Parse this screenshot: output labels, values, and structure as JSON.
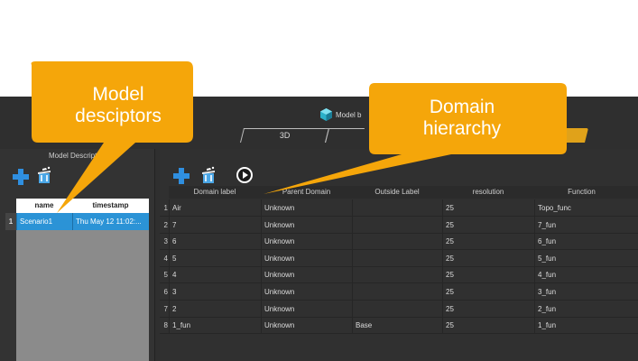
{
  "app": {
    "title": "Model b",
    "tabs": [
      {
        "label": "3D"
      },
      {
        "label": ""
      },
      {
        "label": "s"
      }
    ],
    "colors": {
      "background": "#2f2f2f",
      "accent": "#e0a21a",
      "selection": "#2b93d6"
    }
  },
  "left_panel": {
    "title": "Model Descript",
    "toolbar": {
      "add_icon": "plus-icon",
      "clear_icon": "bin-icon"
    },
    "table": {
      "columns": [
        "name",
        "timestamp"
      ],
      "rows": [
        {
          "num": "1",
          "name": "Scenario1",
          "timestamp": "Thu May 12 11:02:..."
        }
      ]
    }
  },
  "right_panel": {
    "toolbar": {
      "add_icon": "plus-icon",
      "clear_icon": "bin-icon",
      "run_icon": "play-icon"
    },
    "table": {
      "columns": [
        "Domain label",
        "Parent Domain",
        "Outside Label",
        "resolution",
        "Function"
      ],
      "rows": [
        {
          "num": "1",
          "label": "Air",
          "parent": "Unknown",
          "outside": "",
          "resolution": "25",
          "function": "Topo_func"
        },
        {
          "num": "2",
          "label": "7",
          "parent": "Unknown",
          "outside": "",
          "resolution": "25",
          "function": "7_fun"
        },
        {
          "num": "3",
          "label": "6",
          "parent": "Unknown",
          "outside": "",
          "resolution": "25",
          "function": "6_fun"
        },
        {
          "num": "4",
          "label": "5",
          "parent": "Unknown",
          "outside": "",
          "resolution": "25",
          "function": "5_fun"
        },
        {
          "num": "5",
          "label": "4",
          "parent": "Unknown",
          "outside": "",
          "resolution": "25",
          "function": "4_fun"
        },
        {
          "num": "6",
          "label": "3",
          "parent": "Unknown",
          "outside": "",
          "resolution": "25",
          "function": "3_fun"
        },
        {
          "num": "7",
          "label": "2",
          "parent": "Unknown",
          "outside": "",
          "resolution": "25",
          "function": "2_fun"
        },
        {
          "num": "8",
          "label": "1_fun",
          "parent": "Unknown",
          "outside": "Base",
          "resolution": "25",
          "function": "1_fun"
        }
      ]
    }
  },
  "callouts": {
    "left": {
      "line1": "Model",
      "line2": "desciptors",
      "color": "#f5a60a"
    },
    "right": {
      "line1": "Domain",
      "line2": "hierarchy",
      "color": "#f5a60a"
    }
  }
}
